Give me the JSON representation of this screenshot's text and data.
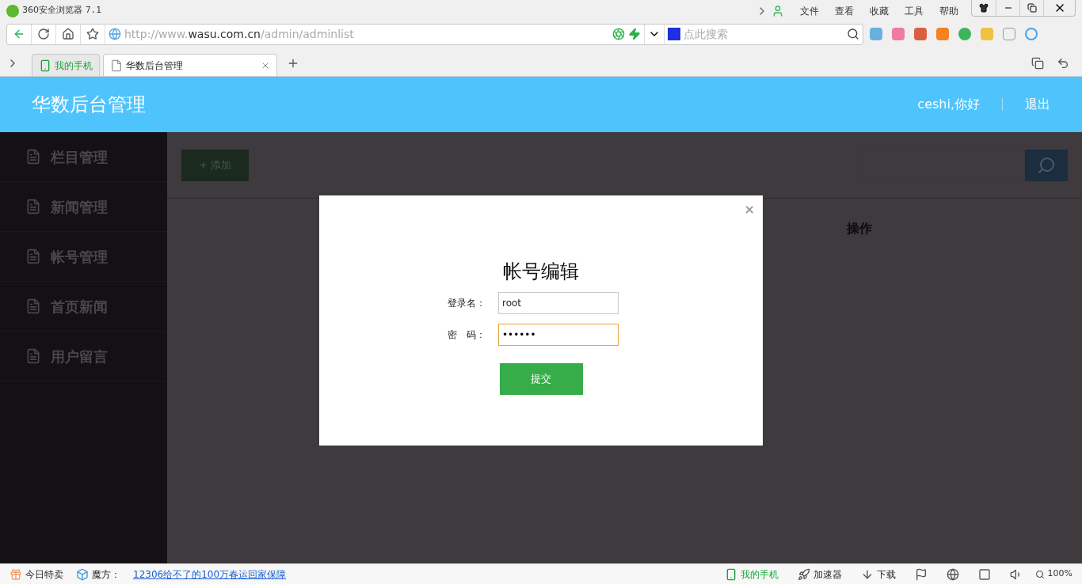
{
  "browser": {
    "title": "360安全浏览器",
    "version": "7.1",
    "menu": [
      "文件",
      "查看",
      "收藏",
      "工具",
      "帮助"
    ],
    "url": {
      "scheme": "http://www.",
      "domain": "wasu.com.cn",
      "path": "/admin/adminlist"
    },
    "search": {
      "placeholder": "点此搜索"
    },
    "tabs": [
      {
        "label": "我的手机",
        "kind": "phone",
        "selected": false
      },
      {
        "label": "华数后台管理",
        "kind": "page",
        "selected": true
      }
    ]
  },
  "header": {
    "title": "华数后台管理",
    "greeting": "ceshi,你好",
    "logout": "退出"
  },
  "sidebar": {
    "items": [
      {
        "label": "栏目管理"
      },
      {
        "label": "新闻管理"
      },
      {
        "label": "帐号管理"
      },
      {
        "label": "首页新闻"
      },
      {
        "label": "用户留言"
      }
    ]
  },
  "toolbar": {
    "add_button": "+ 添加"
  },
  "table": {
    "columns": [
      "操作"
    ]
  },
  "modal": {
    "close": "×",
    "title": "帐号编辑",
    "fields": [
      {
        "label": "登录名：",
        "value": "root",
        "focused": false
      },
      {
        "label": "密　码：",
        "value": "••••••",
        "focused": true
      }
    ],
    "submit": "提交"
  },
  "status_bar": {
    "left": [
      {
        "label": "今日特卖",
        "kind": "gift"
      },
      {
        "label": "魔方：",
        "kind": "cube"
      }
    ],
    "link": "12306给不了的100万春运回家保障",
    "right": [
      {
        "label": "我的手机",
        "kind": "phone"
      },
      {
        "label": "加速器",
        "kind": "rocket"
      },
      {
        "label": "下载",
        "kind": "download"
      }
    ],
    "zoom": "100%"
  }
}
